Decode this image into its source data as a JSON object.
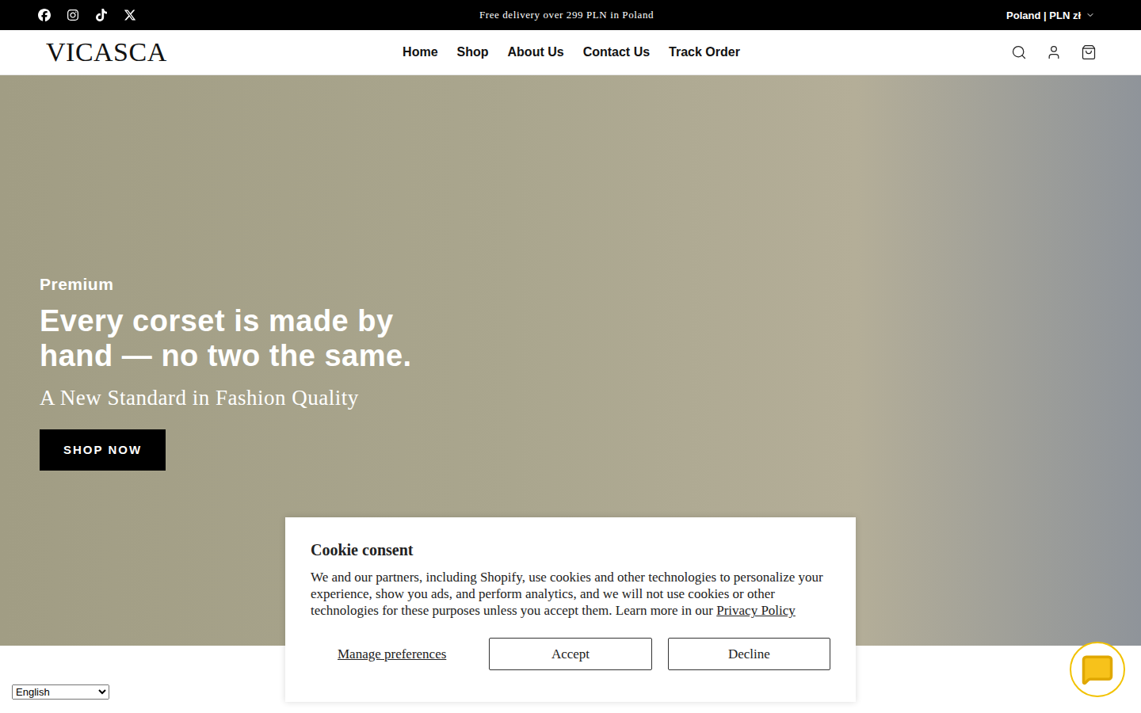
{
  "announcement": {
    "text": "Free delivery over 299 PLN in Poland",
    "locale": "Poland | PLN zł"
  },
  "header": {
    "logo": "VICASCA",
    "nav": [
      {
        "label": "Home"
      },
      {
        "label": "Shop"
      },
      {
        "label": "About Us"
      },
      {
        "label": "Contact Us"
      },
      {
        "label": "Track Order"
      }
    ]
  },
  "hero": {
    "eyebrow": "Premium",
    "heading": "Every corset is made by hand — no two the same.",
    "subheading": "A New Standard in Fashion Quality",
    "button": "SHOP NOW"
  },
  "cookie_consent": {
    "title": "Cookie consent",
    "body": "We and our partners, including Shopify, use cookies and other technologies to personalize your experience, show you ads, and perform analytics, and we will not use cookies or other technologies for these purposes unless you accept them. Learn more in our",
    "link": "Privacy Policy",
    "buttons": [
      "Manage preferences",
      "Accept",
      "Decline"
    ]
  },
  "language_select": {
    "value": "English"
  }
}
